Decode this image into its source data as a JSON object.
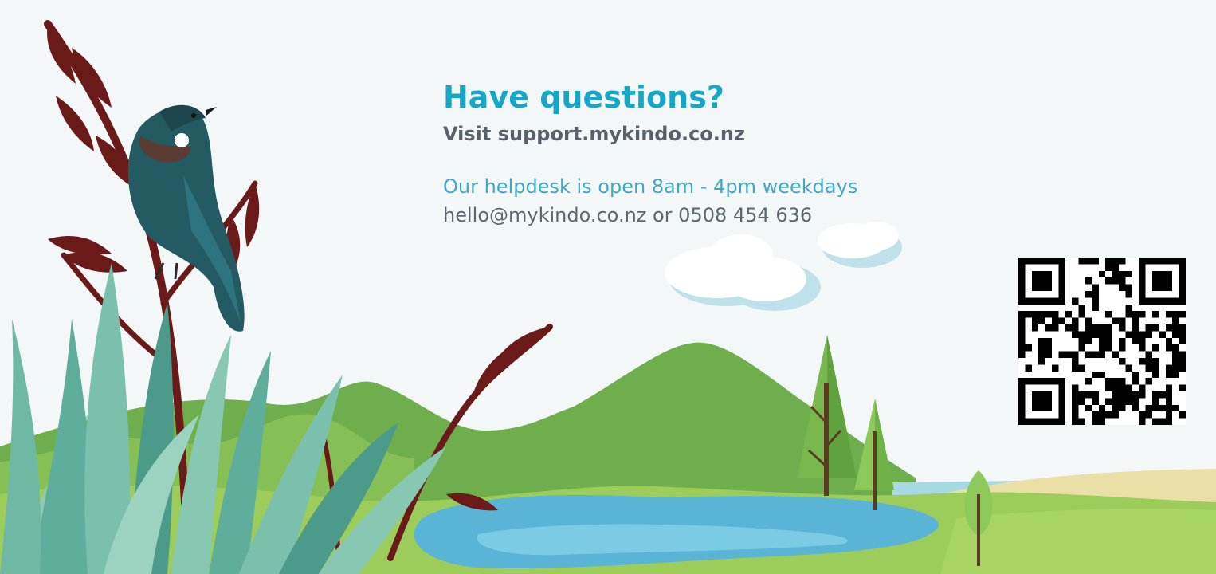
{
  "heading": "Have questions?",
  "support_line": "Visit support.mykindo.co.nz",
  "helpdesk_hours": "Our helpdesk is open 8am - 4pm weekdays",
  "contact_line": "hello@mykindo.co.nz or 0508 454 636",
  "colors": {
    "heading": "#16a6c6",
    "body_text": "#56616b",
    "hours_text": "#3fa9c3",
    "hills_dark": "#6fae4c",
    "hills_light": "#9ccd5a",
    "water": "#5ab4d6",
    "flax_leaves": "#5fae9c",
    "flax_flowers": "#6b1a1a",
    "bird": "#245a62"
  },
  "icons": [
    "tui-bird-illustration",
    "flax-illustration",
    "cloud-illustration",
    "tree-illustration",
    "qr-code"
  ]
}
